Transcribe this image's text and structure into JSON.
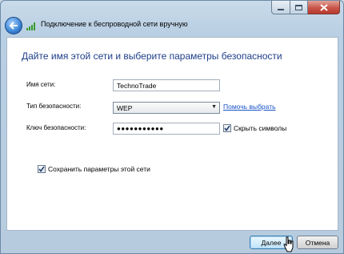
{
  "window": {
    "title": "Подключение к беспроводной сети вручную"
  },
  "main": {
    "heading": "Дайте имя этой сети и выберите параметры безопасности",
    "network_name": {
      "label": "Имя сети:",
      "value": "TechnoTrade"
    },
    "security_type": {
      "label": "Тип безопасности:",
      "value": "WEP",
      "help_link": "Помочь выбрать"
    },
    "security_key": {
      "label": "Ключ безопасности:",
      "value": "●●●●●●●●●●●",
      "hide_chars_label": "Скрыть символы",
      "hide_chars_checked": true
    },
    "save_settings": {
      "label": "Сохранить параметры этой сети",
      "checked": true
    }
  },
  "buttons": {
    "next": "Далее",
    "cancel": "Отмена"
  },
  "colors": {
    "heading": "#1e3f8a",
    "link": "#1a54c8",
    "close_button": "#c9564a"
  }
}
